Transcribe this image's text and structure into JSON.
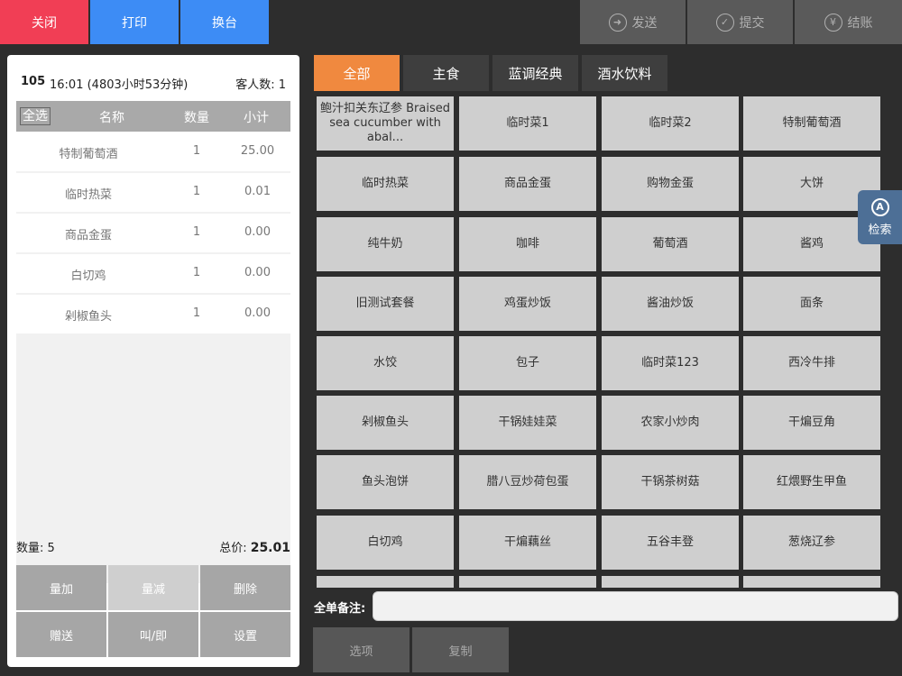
{
  "top_bar": {
    "close_label": "关闭",
    "print_label": "打印",
    "switch_table_label": "换台",
    "send_label": "发送",
    "submit_label": "提交",
    "checkout_label": "结账",
    "checkout_icon": "¥"
  },
  "order": {
    "table_no": "105",
    "time": "16:01 (4803小时53分钟)",
    "guest_count": "客人数: 1",
    "headers": {
      "select_all": "全选",
      "name": "名称",
      "qty": "数量",
      "subtotal": "小计"
    },
    "items": [
      {
        "name": "特制葡萄酒",
        "qty": "1",
        "subtotal": "25.00"
      },
      {
        "name": "临时热菜",
        "qty": "1",
        "subtotal": "0.01"
      },
      {
        "name": "商品金蛋",
        "qty": "1",
        "subtotal": "0.00"
      },
      {
        "name": "白切鸡",
        "qty": "1",
        "subtotal": "0.00"
      },
      {
        "name": "剁椒鱼头",
        "qty": "1",
        "subtotal": "0.00"
      }
    ],
    "qty_label": "数量: ",
    "qty_total": "5",
    "total_label": "总价: ",
    "total_value": "25.01",
    "actions": [
      "量加",
      "量减",
      "删除",
      "赠送",
      "叫/即",
      "设置"
    ]
  },
  "categories": [
    "全部",
    "主食",
    "蓝调经典",
    "酒水饮料"
  ],
  "dishes": [
    "鲍汁扣关东辽参 Braised sea cucumber with abal...",
    "临时菜1",
    "临时菜2",
    "特制葡萄酒",
    "临时热菜",
    "商品金蛋",
    "购物金蛋",
    "大饼",
    "纯牛奶",
    "咖啡",
    "葡萄酒",
    "酱鸡",
    "旧测试套餐",
    "鸡蛋炒饭",
    "酱油炒饭",
    "面条",
    "水饺",
    "包子",
    "临时菜123",
    "西冷牛排",
    "剁椒鱼头",
    "干锅娃娃菜",
    "农家小炒肉",
    "干煸豆角",
    "鱼头泡饼",
    "腊八豆炒荷包蛋",
    "干锅茶树菇",
    "红煨野生甲鱼",
    "白切鸡",
    "干煸藕丝",
    "五谷丰登",
    "葱烧辽参",
    "",
    "",
    "",
    ""
  ],
  "search_label": "检索",
  "search_icon": "A",
  "remark_label": "全单备注:",
  "remark_value": "",
  "bottom": {
    "options_label": "选项",
    "copy_label": "复制"
  }
}
